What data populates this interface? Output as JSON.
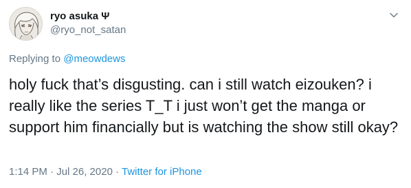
{
  "author": {
    "display_name": "ryo asuka Ψ",
    "handle": "@ryo_not_satan",
    "avatar_icon": "anime-character-avatar"
  },
  "menu_icon": "chevron-down-icon",
  "reply": {
    "prefix": "Replying to ",
    "mention": "@meowdews"
  },
  "tweet": {
    "text": "holy fuck that’s disgusting. can i still watch eizouken? i really like the series T_T i just won’t get the manga or support him financially but is watching the show still okay?"
  },
  "meta": {
    "time": "1:14 PM · Jul 26, 2020",
    "separator": " · ",
    "source": "Twitter for iPhone"
  },
  "colors": {
    "text": "#14171a",
    "secondary": "#657786",
    "link": "#1b95e0"
  }
}
